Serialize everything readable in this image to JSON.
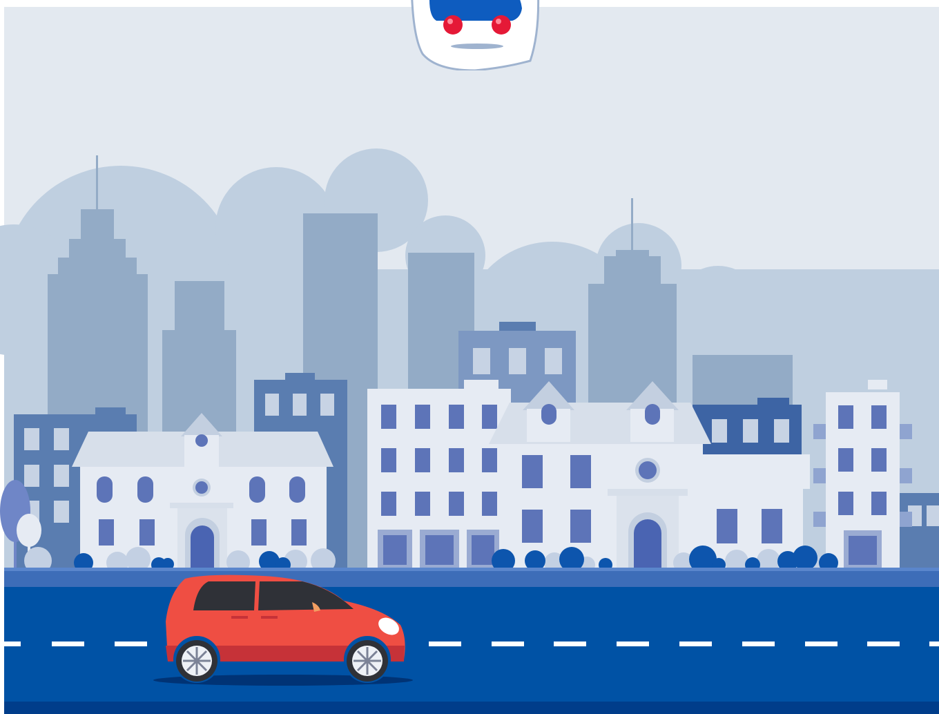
{
  "scene": {
    "description_visible_text": [],
    "colors": {
      "sky": "#e3e9f0",
      "cloud": "#bfcfe0",
      "skyscraper": "#93abc6",
      "mid_building": "#5a7db0",
      "mid_building_light": "#7d98c2",
      "house": "#e6ebf3",
      "house_roof": "#d7dfea",
      "window": "#5d74b8",
      "window_frame": "#c3cfe0",
      "bush_dark": "#0d55ad",
      "bush_light": "#c3d0e3",
      "sidewalk": "#3d6db8",
      "road": "#0052a5",
      "road_edge": "#003d8a",
      "lane_marking": "#ffffff",
      "car_body": "#ef4e43",
      "car_body_dark": "#c63238",
      "car_window": "#2f3137",
      "car_headlight": "#ffffff",
      "logo_blue": "#0e5cbf",
      "logo_red": "#e51937"
    }
  },
  "logo": {
    "icon": "car-logo-icon"
  }
}
